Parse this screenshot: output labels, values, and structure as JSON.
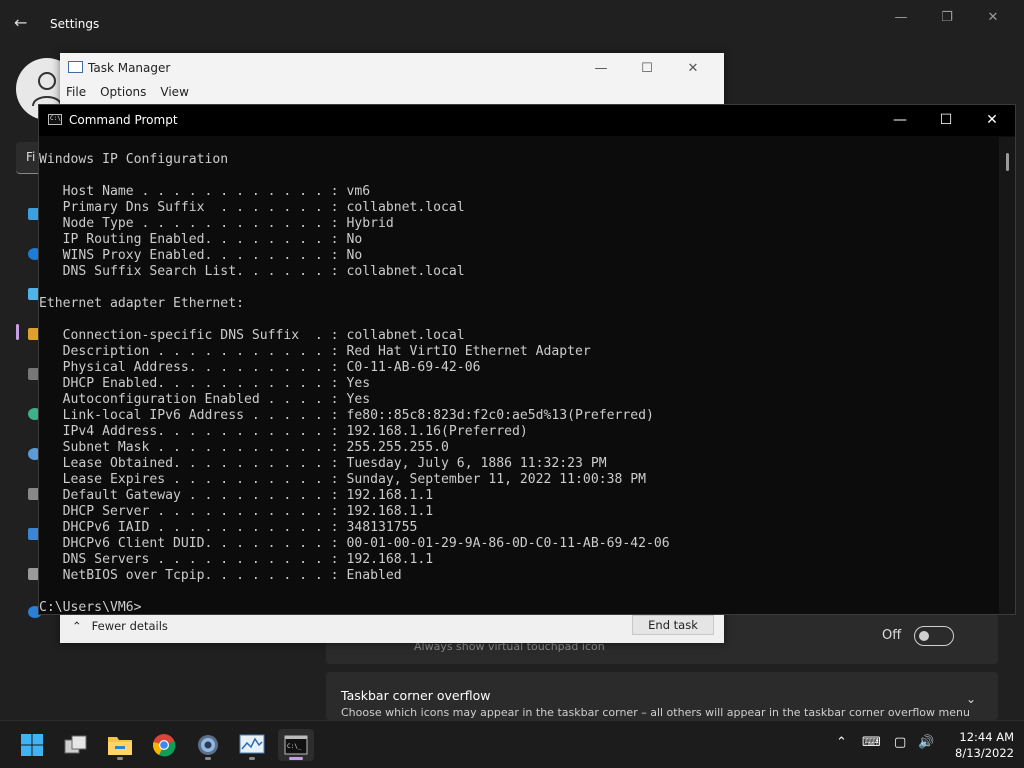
{
  "settings": {
    "title": "Settings",
    "search_partial": "Fi",
    "touchpad_card": {
      "subtitle": "Always show virtual touchpad icon",
      "toggle_label": "Off"
    },
    "overflow_card": {
      "title": "Taskbar corner overflow",
      "subtitle": "Choose which icons may appear in the taskbar corner – all others will appear in the taskbar corner overflow menu"
    }
  },
  "task_manager": {
    "title": "Task Manager",
    "menu": [
      "File",
      "Options",
      "View"
    ],
    "fewer_details": "Fewer details",
    "end_task": "End task"
  },
  "command_prompt": {
    "title": "Command Prompt",
    "lines": [
      "Windows IP Configuration",
      "",
      "   Host Name . . . . . . . . . . . . : vm6",
      "   Primary Dns Suffix  . . . . . . . : collabnet.local",
      "   Node Type . . . . . . . . . . . . : Hybrid",
      "   IP Routing Enabled. . . . . . . . : No",
      "   WINS Proxy Enabled. . . . . . . . : No",
      "   DNS Suffix Search List. . . . . . : collabnet.local",
      "",
      "Ethernet adapter Ethernet:",
      "",
      "   Connection-specific DNS Suffix  . : collabnet.local",
      "   Description . . . . . . . . . . . : Red Hat VirtIO Ethernet Adapter",
      "   Physical Address. . . . . . . . . : C0-11-AB-69-42-06",
      "   DHCP Enabled. . . . . . . . . . . : Yes",
      "   Autoconfiguration Enabled . . . . : Yes",
      "   Link-local IPv6 Address . . . . . : fe80::85c8:823d:f2c0:ae5d%13(Preferred)",
      "   IPv4 Address. . . . . . . . . . . : 192.168.1.16(Preferred)",
      "   Subnet Mask . . . . . . . . . . . : 255.255.255.0",
      "   Lease Obtained. . . . . . . . . . : Tuesday, July 6, 1886 11:32:23 PM",
      "   Lease Expires . . . . . . . . . . : Sunday, September 11, 2022 11:00:38 PM",
      "   Default Gateway . . . . . . . . . : 192.168.1.1",
      "   DHCP Server . . . . . . . . . . . : 192.168.1.1",
      "   DHCPv6 IAID . . . . . . . . . . . : 348131755",
      "   DHCPv6 Client DUID. . . . . . . . : 00-01-00-01-29-9A-86-0D-C0-11-AB-69-42-06",
      "   DNS Servers . . . . . . . . . . . : 192.168.1.1",
      "   NetBIOS over Tcpip. . . . . . . . : Enabled",
      "",
      "C:\\Users\\VM6>"
    ]
  },
  "taskbar": {
    "apps": [
      {
        "name": "start-button",
        "icon": "windows-logo-icon"
      },
      {
        "name": "task-view-button",
        "icon": "task-view-icon"
      },
      {
        "name": "file-explorer-button",
        "icon": "folder-icon"
      },
      {
        "name": "chrome-button",
        "icon": "chrome-icon"
      },
      {
        "name": "settings-button",
        "icon": "gear-icon"
      },
      {
        "name": "task-manager-button",
        "icon": "task-manager-icon"
      },
      {
        "name": "command-prompt-button",
        "icon": "terminal-icon"
      }
    ],
    "clock": {
      "time": "12:44 AM",
      "date": "8/13/2022"
    }
  },
  "colors": {
    "accent": "#c79fe5",
    "terminal_bg": "#0c0c0c",
    "terminal_fg": "#cccccc"
  }
}
